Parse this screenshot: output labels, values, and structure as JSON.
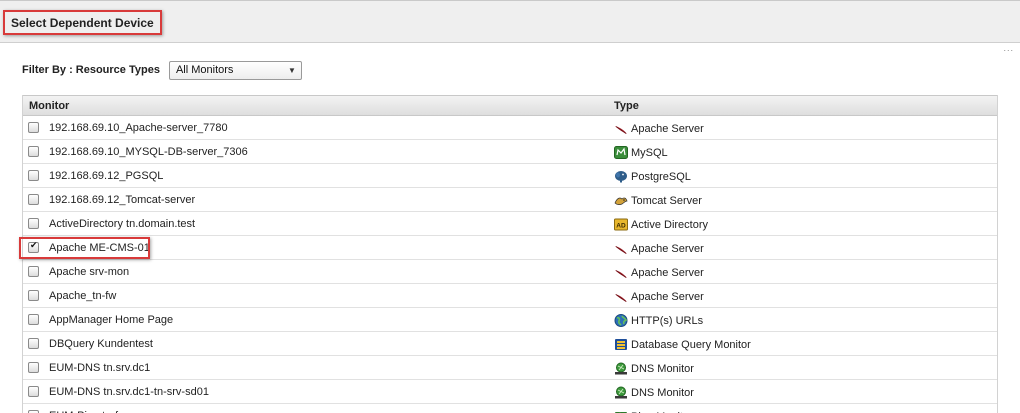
{
  "header": {
    "title": "Select Dependent Device"
  },
  "overflow_marker": "...",
  "filter": {
    "label": "Filter By :  Resource Types",
    "selected": "All Monitors"
  },
  "table": {
    "columns": [
      "Monitor",
      "Type"
    ],
    "rows": [
      {
        "monitor": "192.168.69.10_Apache-server_7780",
        "type": "Apache Server",
        "icon": "apache-feather-icon",
        "checked": false
      },
      {
        "monitor": "192.168.69.10_MYSQL-DB-server_7306",
        "type": "MySQL",
        "icon": "mysql-icon",
        "checked": false
      },
      {
        "monitor": "192.168.69.12_PGSQL",
        "type": "PostgreSQL",
        "icon": "postgresql-elephant-icon",
        "checked": false
      },
      {
        "monitor": "192.168.69.12_Tomcat-server",
        "type": "Tomcat Server",
        "icon": "tomcat-icon",
        "checked": false
      },
      {
        "monitor": "ActiveDirectory tn.domain.test",
        "type": "Active Directory",
        "icon": "active-directory-icon",
        "checked": false
      },
      {
        "monitor": "Apache ME-CMS-01",
        "type": "Apache Server",
        "icon": "apache-feather-icon",
        "checked": true
      },
      {
        "monitor": "Apache srv-mon",
        "type": "Apache Server",
        "icon": "apache-feather-icon",
        "checked": false
      },
      {
        "monitor": "Apache_tn-fw",
        "type": "Apache Server",
        "icon": "apache-feather-icon",
        "checked": false
      },
      {
        "monitor": "AppManager Home Page",
        "type": "HTTP(s) URLs",
        "icon": "globe-icon",
        "checked": false
      },
      {
        "monitor": "DBQuery Kundentest",
        "type": "Database Query Monitor",
        "icon": "database-query-icon",
        "checked": false
      },
      {
        "monitor": "EUM-DNS tn.srv.dc1",
        "type": "DNS Monitor",
        "icon": "dns-icon",
        "checked": false
      },
      {
        "monitor": "EUM-DNS tn.srv.dc1-tn-srv-sd01",
        "type": "DNS Monitor",
        "icon": "dns-icon",
        "checked": false
      },
      {
        "monitor": "EUM-Ping tn-fw",
        "type": "Ping Monitor",
        "icon": "ping-icon",
        "checked": false
      }
    ]
  }
}
